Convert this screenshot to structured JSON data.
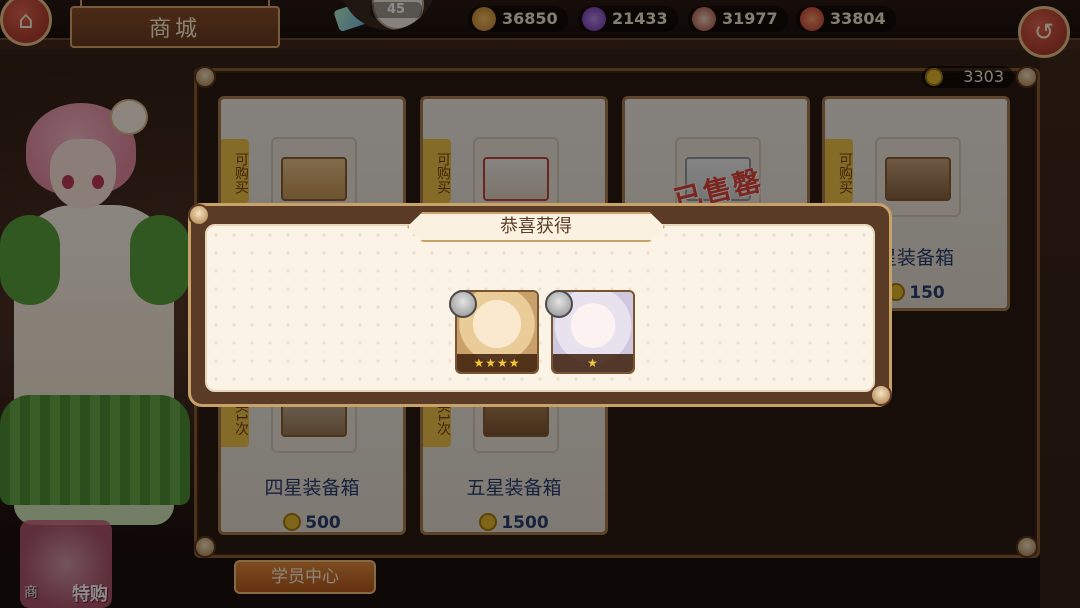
{
  "header": {
    "title": "商城",
    "level": "45",
    "currencies": [
      {
        "name": "potion",
        "value": "36850",
        "color": "#e6a03a"
      },
      {
        "name": "crystal",
        "value": "21433",
        "color": "#8a4cc7"
      },
      {
        "name": "cake",
        "value": "31977",
        "color": "#c94a3a"
      },
      {
        "name": "apple",
        "value": "33804",
        "color": "#d0453a"
      }
    ]
  },
  "shop": {
    "points": "3303",
    "cards": [
      {
        "tag": "可购买",
        "name": "",
        "price": ""
      },
      {
        "tag": "可购买",
        "name": "",
        "price": ""
      },
      {
        "tag": "",
        "name": "",
        "price": "",
        "soldout": "已售罄"
      },
      {
        "tag": "可购买",
        "name": "星装备箱",
        "price": "150"
      },
      {
        "tag": "买1次",
        "name": "四星装备箱",
        "price": "500"
      },
      {
        "tag": "买1次",
        "name": "五星装备箱",
        "price": "1500"
      }
    ],
    "student_center": "学员中心"
  },
  "promo": {
    "label": "特购",
    "label2": "商"
  },
  "dialog": {
    "title": "恭喜获得",
    "rewards": [
      {
        "stars": "★★★★",
        "star_count": 4,
        "character": "blonde-girl"
      },
      {
        "stars": "★",
        "star_count": 1,
        "character": "white-hair-girl"
      }
    ]
  },
  "colors": {
    "accent": "#c9a26a",
    "button": "#b85a1e",
    "text": "#2a3e70"
  }
}
